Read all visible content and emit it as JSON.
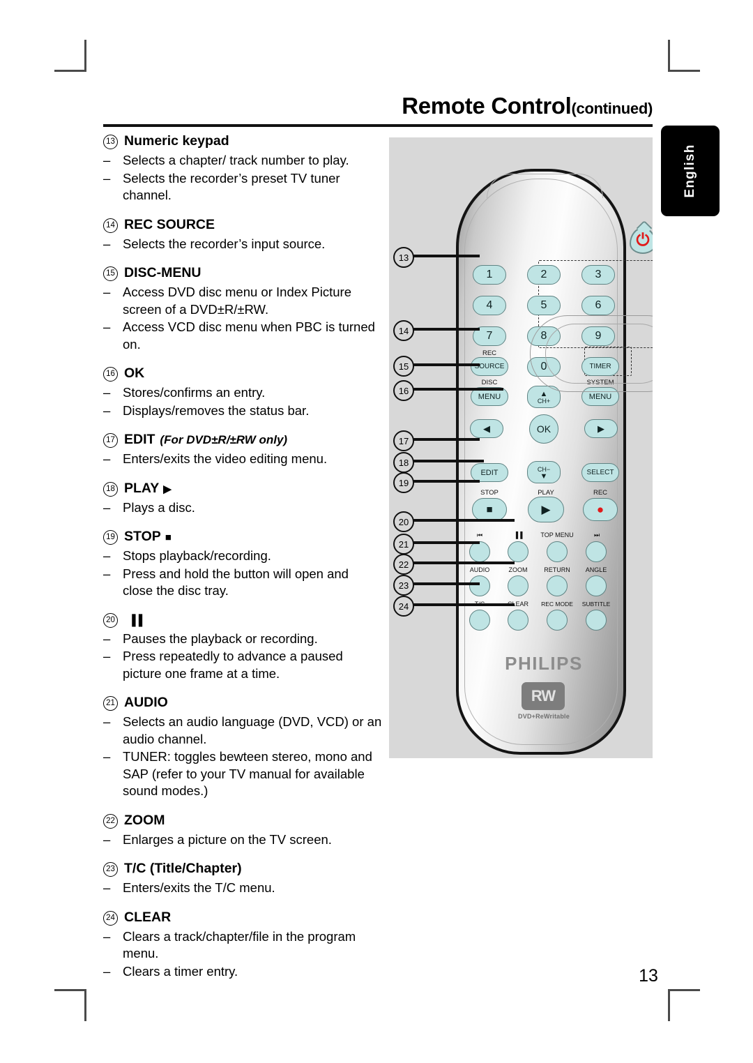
{
  "header": {
    "title": "Remote Control",
    "continued": "(continued)"
  },
  "language_tab": {
    "label": "English"
  },
  "page_number": "13",
  "entries": [
    {
      "num": "13",
      "label": "Numeric keypad",
      "note": "",
      "glyph": "",
      "bullets": [
        "Selects a chapter/ track number to play.",
        "Selects the recorder’s preset TV tuner channel."
      ]
    },
    {
      "num": "14",
      "label": "REC SOURCE",
      "note": "",
      "glyph": "",
      "bullets": [
        "Selects the recorder’s input source."
      ]
    },
    {
      "num": "15",
      "label": "DISC-MENU",
      "note": "",
      "glyph": "",
      "bullets": [
        "Access DVD disc menu or Index Picture screen of a DVD±R/±RW.",
        "Access VCD disc menu when PBC is turned on."
      ]
    },
    {
      "num": "16",
      "label": "OK",
      "note": "",
      "glyph": "",
      "bullets": [
        "Stores/confirms an entry.",
        "Displays/removes the status bar."
      ]
    },
    {
      "num": "17",
      "label": "EDIT",
      "note": "(For DVD±R/±RW only)",
      "glyph": "",
      "bullets": [
        "Enters/exits the video editing menu."
      ]
    },
    {
      "num": "18",
      "label": "PLAY",
      "note": "",
      "glyph": "▶",
      "bullets": [
        "Plays a disc."
      ]
    },
    {
      "num": "19",
      "label": "STOP",
      "note": "",
      "glyph": "■",
      "bullets": [
        "Stops playback/recording.",
        "Press and hold the button will open and close the disc tray."
      ]
    },
    {
      "num": "20",
      "label": "",
      "note": "",
      "glyph": "▐▐",
      "bullets": [
        "Pauses the playback or recording.",
        "Press repeatedly to advance a paused picture one frame at a time."
      ]
    },
    {
      "num": "21",
      "label": "AUDIO",
      "note": "",
      "glyph": "",
      "bullets": [
        "Selects an audio language (DVD, VCD) or an audio channel.",
        "TUNER: toggles bewteen stereo, mono and SAP (refer to your TV manual for available sound modes.)"
      ]
    },
    {
      "num": "22",
      "label": "ZOOM",
      "note": "",
      "glyph": "",
      "bullets": [
        "Enlarges a picture on the TV screen."
      ]
    },
    {
      "num": "23",
      "label": "T/C (Title/Chapter)",
      "note": "",
      "glyph": "",
      "bullets": [
        "Enters/exits the T/C menu."
      ]
    },
    {
      "num": "24",
      "label": "CLEAR",
      "note": "",
      "glyph": "",
      "bullets": [
        "Clears a track/chapter/file in the program menu.",
        "Clears a timer entry."
      ]
    }
  ],
  "remote": {
    "brand": "PHILIPS",
    "badge": "RW",
    "badge_sub": "DVD+ReWritable",
    "power_symbol": "⏻",
    "keypad": [
      "1",
      "2",
      "3",
      "4",
      "5",
      "6",
      "7",
      "8",
      "9"
    ],
    "zero_key": "0",
    "rec_source_caption": "REC",
    "rec_source": "SOURCE",
    "timer": "TIMER",
    "disc_caption": "DISC",
    "disc_menu": "MENU",
    "system_caption": "SYSTEM",
    "system_menu": "MENU",
    "ch_up": "CH+",
    "ch_down": "CH−",
    "ok": "OK",
    "edit": "EDIT",
    "select": "SELECT",
    "left_arrow": "◀",
    "right_arrow": "▶",
    "up_arrow": "▲",
    "down_arrow": "▼",
    "stop_caption": "STOP",
    "play_caption": "PLAY",
    "rec_caption": "REC",
    "stop_glyph": "■",
    "play_glyph": "▶",
    "rec_glyph": "●",
    "prev_caption": "⏮",
    "pause_caption": "▐▐",
    "top_menu_caption": "TOP MENU",
    "next_caption": "⏭",
    "audio_caption": "AUDIO",
    "zoom_caption": "ZOOM",
    "return_caption": "RETURN",
    "angle_caption": "ANGLE",
    "tc_caption": "T/C",
    "clear_caption": "CLEAR",
    "recmode_caption": "REC MODE",
    "subtitle_caption": "SUBTITLE"
  },
  "callouts": [
    "13",
    "14",
    "15",
    "16",
    "17",
    "18",
    "19",
    "20",
    "21",
    "22",
    "23",
    "24"
  ],
  "colors": {
    "button_fill": "#bfe4e4",
    "panel_bg": "#d8d8d8",
    "rec_red": "#e11a1a",
    "tab_bg": "#000000"
  }
}
